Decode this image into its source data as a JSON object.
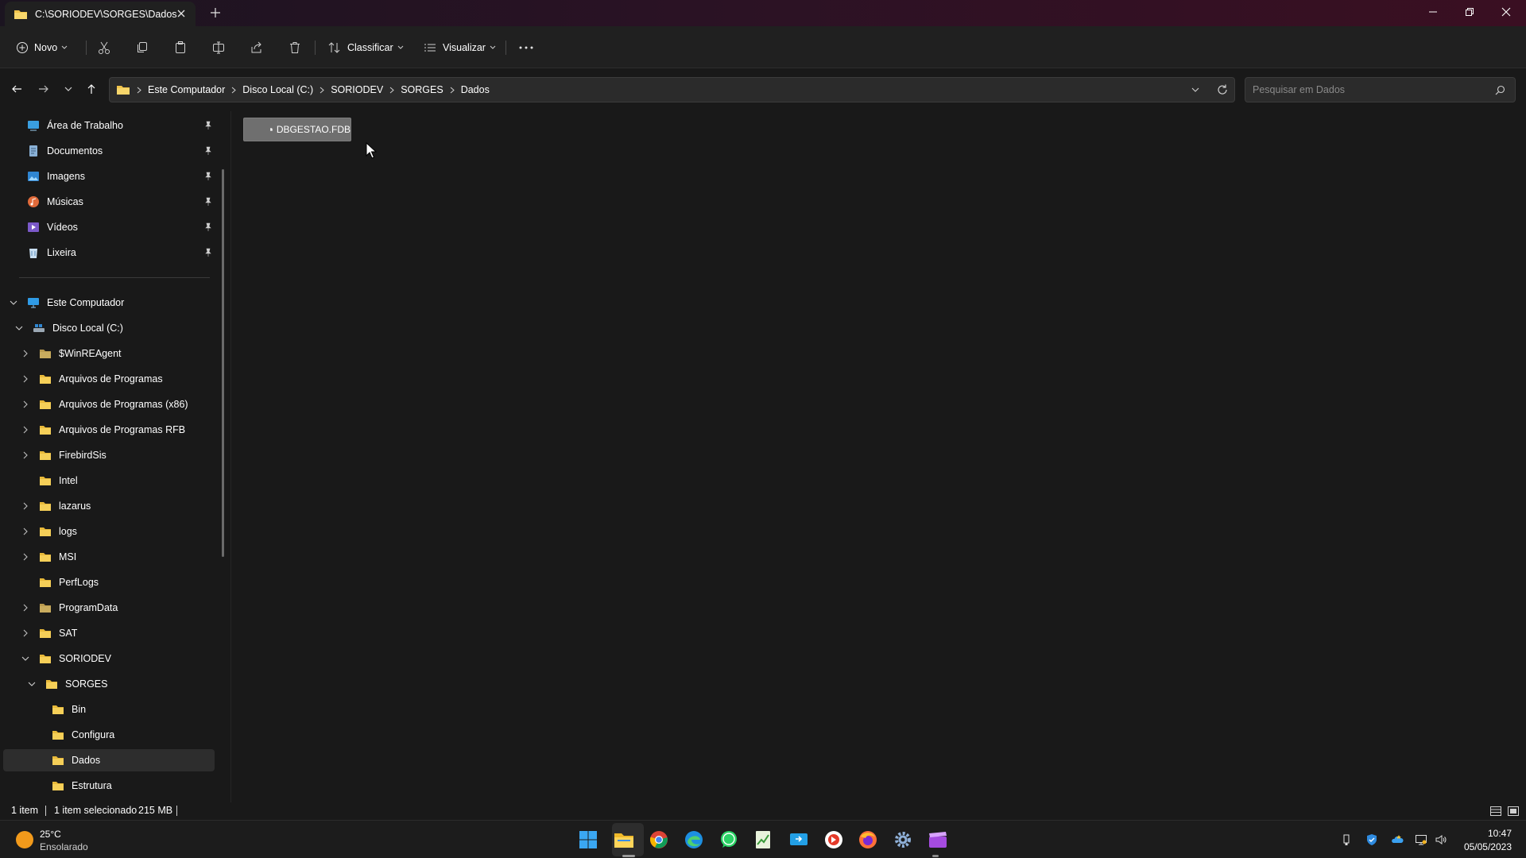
{
  "window": {
    "tab_title": "C:\\SORIODEV\\SORGES\\Dados"
  },
  "toolbar": {
    "new_label": "Novo",
    "sort_label": "Classificar",
    "view_label": "Visualizar"
  },
  "breadcrumb": [
    "Este Computador",
    "Disco Local (C:)",
    "SORIODEV",
    "SORGES",
    "Dados"
  ],
  "search": {
    "placeholder": "Pesquisar em Dados"
  },
  "quick_access": [
    {
      "label": "Área de Trabalho",
      "icon": "desktop-icon"
    },
    {
      "label": "Documentos",
      "icon": "documents-icon"
    },
    {
      "label": "Imagens",
      "icon": "pictures-icon"
    },
    {
      "label": "Músicas",
      "icon": "music-icon"
    },
    {
      "label": "Vídeos",
      "icon": "videos-icon"
    },
    {
      "label": "Lixeira",
      "icon": "recycle-bin-icon"
    }
  ],
  "tree": {
    "this_pc": "Este Computador",
    "drive": "Disco Local (C:)",
    "folders": [
      {
        "label": "$WinREAgent"
      },
      {
        "label": "Arquivos de Programas"
      },
      {
        "label": "Arquivos de Programas (x86)"
      },
      {
        "label": "Arquivos de Programas RFB"
      },
      {
        "label": "FirebirdSis"
      },
      {
        "label": "Intel"
      },
      {
        "label": "lazarus"
      },
      {
        "label": "logs"
      },
      {
        "label": "MSI"
      },
      {
        "label": "PerfLogs"
      },
      {
        "label": "ProgramData"
      },
      {
        "label": "SAT"
      },
      {
        "label": "SORIODEV"
      }
    ],
    "sorges": "SORGES",
    "sorges_children": [
      {
        "label": "Bin"
      },
      {
        "label": "Configura"
      },
      {
        "label": "Dados"
      },
      {
        "label": "Estrutura"
      }
    ],
    "selected": "Dados"
  },
  "content": {
    "files": [
      {
        "name": "DBGESTAO.FDB",
        "icon": "file-icon",
        "selected": true
      }
    ]
  },
  "status": {
    "item_count": "1 item",
    "selection": "1 item selecionado",
    "size": "215 MB"
  },
  "taskbar": {
    "weather_temp": "25°C",
    "weather_desc": "Ensolarado",
    "apps": [
      "start-icon",
      "file-explorer-icon",
      "chrome-icon",
      "edge-icon",
      "whatsapp-icon",
      "spreadsheet-icon",
      "remote-desktop-icon",
      "app-icon",
      "firefox-icon",
      "settings-icon",
      "clapper-icon"
    ],
    "time": "10:47",
    "date": "05/05/2023"
  },
  "colors": {
    "accent": "#4cc2ff",
    "folder": "#f0c34a",
    "selection": "#6f6f6f"
  }
}
